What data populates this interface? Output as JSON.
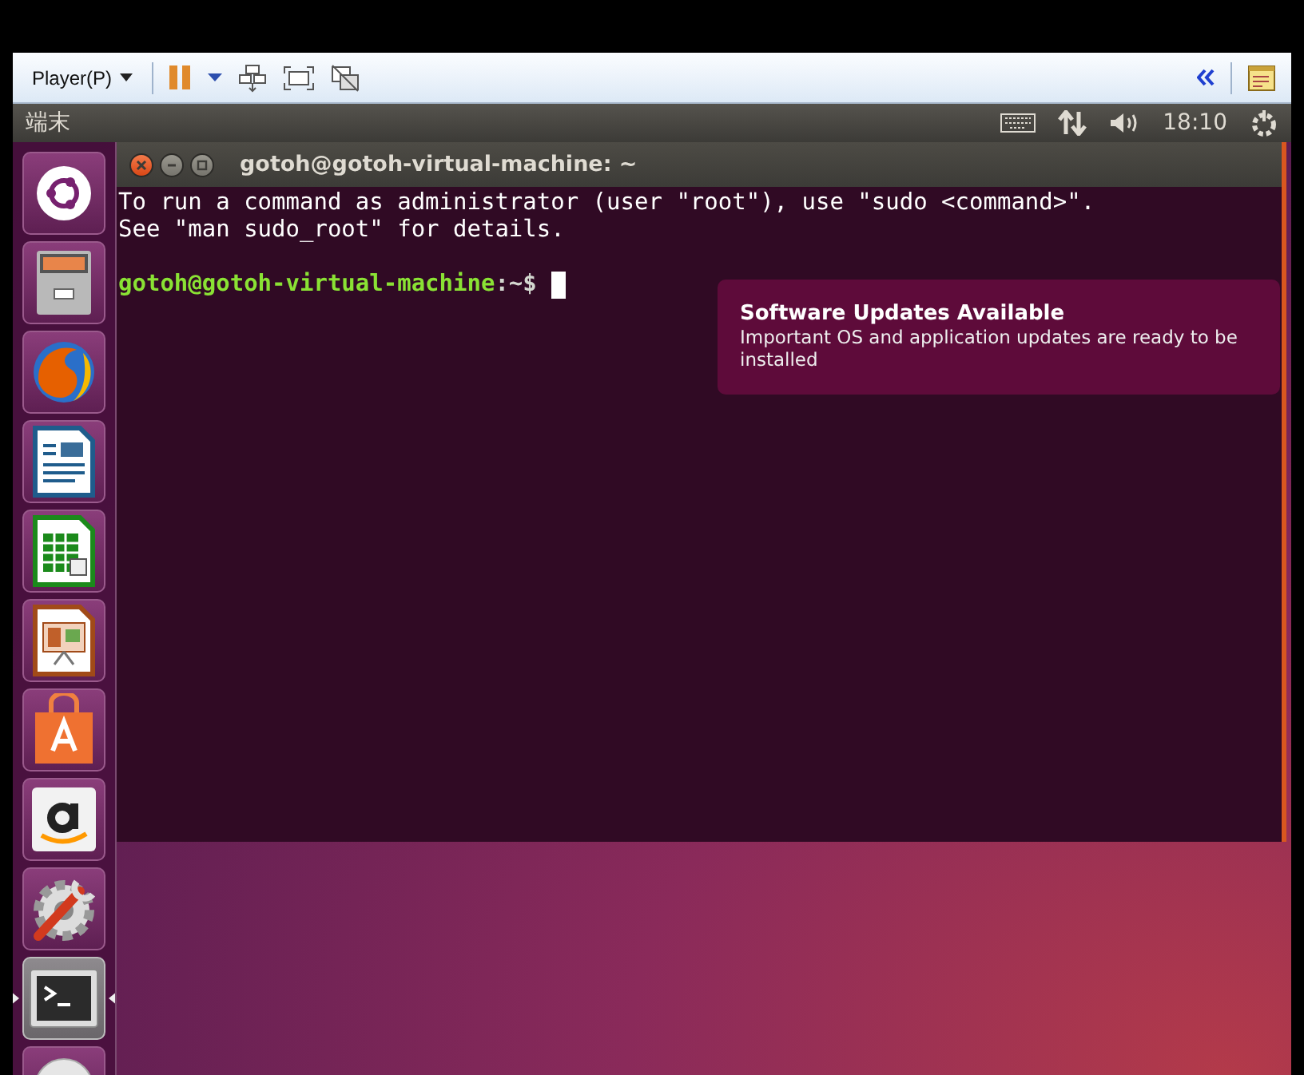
{
  "player_toolbar": {
    "menu": "Player(P)"
  },
  "top_panel": {
    "title": "端末",
    "clock": "18:10"
  },
  "launcher": [
    {
      "kind": "ubuntu",
      "active": false
    },
    {
      "kind": "files",
      "active": false
    },
    {
      "kind": "firefox",
      "active": false
    },
    {
      "kind": "writer",
      "active": false
    },
    {
      "kind": "calc",
      "active": false
    },
    {
      "kind": "impress",
      "active": false
    },
    {
      "kind": "software",
      "active": false
    },
    {
      "kind": "amazon",
      "active": false
    },
    {
      "kind": "settings",
      "active": false
    },
    {
      "kind": "terminal",
      "active": true
    },
    {
      "kind": "disc",
      "active": false
    }
  ],
  "terminal": {
    "title": "gotoh@gotoh-virtual-machine: ~",
    "lines": [
      "To run a command as administrator (user \"root\"), use \"sudo <command>\".",
      "See \"man sudo_root\" for details."
    ],
    "prompt_user": "gotoh@gotoh-virtual-machine",
    "prompt_tail": ":~$"
  },
  "notification": {
    "title": "Software Updates Available",
    "body": "Important OS and application updates are ready to be installed"
  }
}
